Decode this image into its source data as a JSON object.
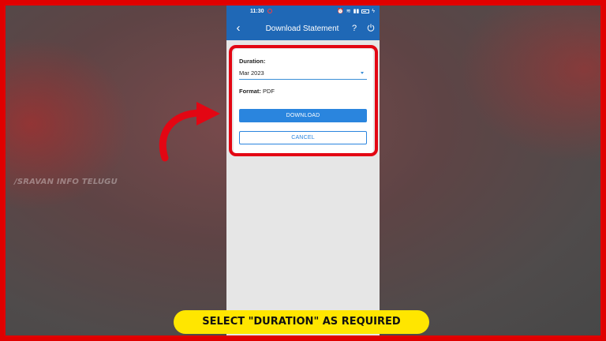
{
  "status_bar": {
    "time": "11:30"
  },
  "app_bar": {
    "back_icon": "arrow-back-icon",
    "title": "Download Statement",
    "help_label": "?",
    "power_icon": "power-icon"
  },
  "form": {
    "duration_label": "Duration:",
    "duration_value": "Mar 2023",
    "format_label": "Format:",
    "format_value": "PDF",
    "download_label": "DOWNLOAD",
    "cancel_label": "CANCEL"
  },
  "overlay": {
    "watermark": "/SRAVAN INFO TELUGU",
    "caption": "SELECT \"DURATION\" AS REQUIRED",
    "highlight_color": "#e30613",
    "arrow_color": "#e30613"
  },
  "colors": {
    "app_bar": "#1f68b6",
    "accent": "#2a85de",
    "frame": "#e00000",
    "caption_bg": "#ffe600"
  }
}
